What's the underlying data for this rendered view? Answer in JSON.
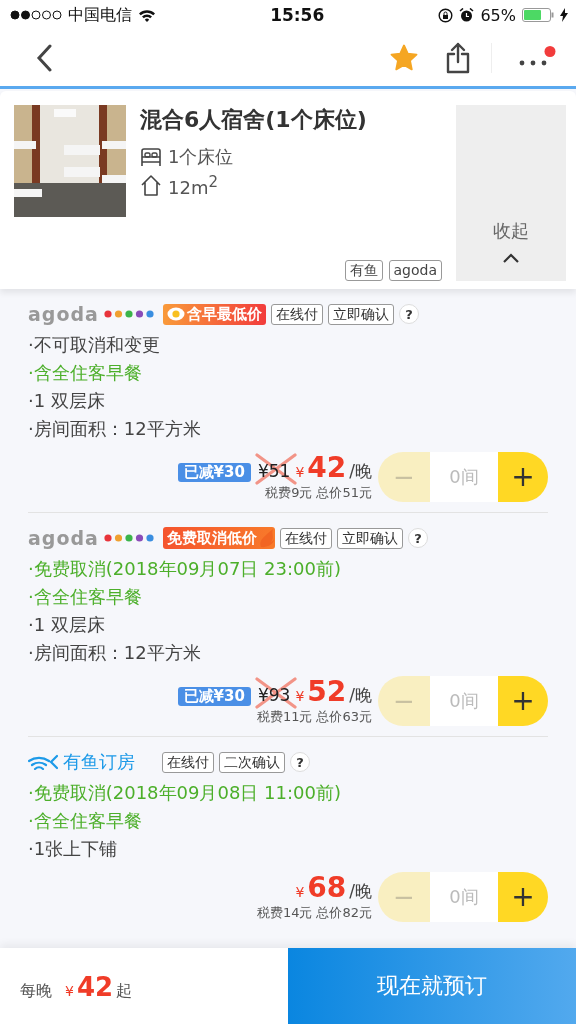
{
  "status_bar": {
    "carrier": "中国电信",
    "time": "15:56",
    "battery": "65%"
  },
  "nav": {
    "favorited": true,
    "more_notification": true
  },
  "room": {
    "kind": "picture",
    "title": "混合6人宿舍(1个床位)",
    "beds": "1个床位",
    "area": "12m$^{2}$",
    "tags": [
      "有鱼",
      "agoda"
    ],
    "collapse": "收起"
  },
  "offers": [
    {
      "kind": "agoda",
      "source_name": "agoda",
      "promo": {
        "kind": "breakfast",
        "label": "含早最低价"
      },
      "tags": [
        "在线付",
        "立即确认"
      ],
      "help": "?",
      "lines": [
        {
          "text": "·不可取消和变更",
          "highlight": false
        },
        {
          "text": "·含全住客早餐",
          "highlight": true
        },
        {
          "text": "·1 双层床",
          "highlight": false
        },
        {
          "text": "·房间面积：12平方米",
          "highlight": false
        }
      ],
      "discount": "已减¥30",
      "old_price": "¥51",
      "currency": "¥",
      "price": "42",
      "unit": "/晚",
      "tax": "税费9元",
      "total": "总价51元",
      "stepper": {
        "minus": "−",
        "count": "0间",
        "plus": "+",
        "minus_disabled": true
      }
    },
    {
      "kind": "agoda",
      "source_name": "agoda",
      "promo": {
        "kind": "free_cancel",
        "label": "免费取消低价"
      },
      "tags": [
        "在线付",
        "立即确认"
      ],
      "help": "?",
      "lines": [
        {
          "text": "·免费取消(2018年09月07日 23:00前)",
          "highlight": true
        },
        {
          "text": "·含全住客早餐",
          "highlight": true
        },
        {
          "text": "·1 双层床",
          "highlight": false
        },
        {
          "text": "·房间面积：12平方米",
          "highlight": false
        }
      ],
      "discount": "已减¥30",
      "old_price": "¥93",
      "currency": "¥",
      "price": "52",
      "unit": "/晚",
      "tax": "税费11元",
      "total": "总价63元",
      "stepper": {
        "minus": "−",
        "count": "0间",
        "plus": "+",
        "minus_disabled": true
      }
    },
    {
      "kind": "youyu",
      "source_name": "有鱼订房",
      "tags": [
        "在线付",
        "二次确认"
      ],
      "help": "?",
      "lines": [
        {
          "text": "·免费取消(2018年09月08日 11:00前)",
          "highlight": true
        },
        {
          "text": "·含全住客早餐",
          "highlight": true
        },
        {
          "text": "·1张上下铺",
          "highlight": false
        }
      ],
      "currency": "¥",
      "price": "68",
      "unit": "/晚",
      "tax": "税费14元",
      "total": "总价82元",
      "stepper": {
        "minus": "−",
        "count": "0间",
        "plus": "+",
        "minus_disabled": true
      }
    }
  ],
  "bottom_bar": {
    "label": "每晚",
    "currency": "¥",
    "price": "42",
    "suffix": "起",
    "book": "现在就预订"
  }
}
